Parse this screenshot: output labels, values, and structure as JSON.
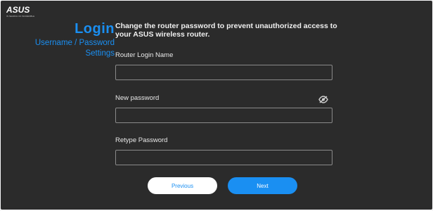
{
  "brand": {
    "logo_text": "ASUS",
    "tagline": "IN SEARCH OF INCREDIBLE"
  },
  "sidebar": {
    "title": "Login",
    "subtitle_line1": "Username / Password",
    "subtitle_line2": "Settings"
  },
  "main": {
    "description": "Change the router password to prevent unauthorized access to your ASUS wireless router."
  },
  "form": {
    "login_name_label": "Router Login Name",
    "login_name_value": "",
    "new_password_label": "New password",
    "new_password_value": "",
    "retype_password_label": "Retype Password",
    "retype_password_value": ""
  },
  "buttons": {
    "previous_label": "Previous",
    "next_label": "Next"
  },
  "colors": {
    "accent": "#1a8ff2",
    "background": "#2b2b2b",
    "page": "#f7f7f8"
  }
}
